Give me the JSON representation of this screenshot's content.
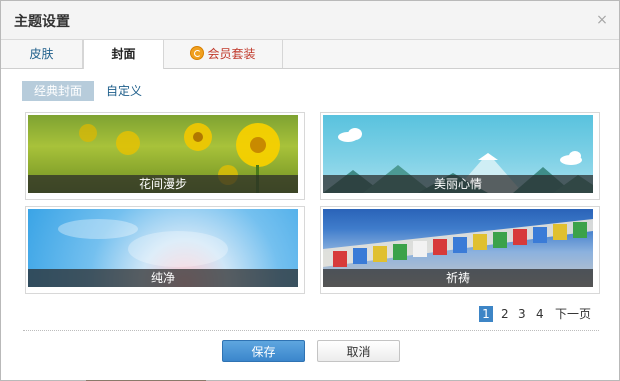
{
  "dialog": {
    "title": "主题设置",
    "close_symbol": "×"
  },
  "tabs": [
    {
      "label": "皮肤",
      "active": false
    },
    {
      "label": "封面",
      "active": true
    },
    {
      "label": "会员套装",
      "active": false,
      "icon": "vip-coin-icon"
    }
  ],
  "subtabs": [
    {
      "label": "经典封面",
      "active": true
    },
    {
      "label": "自定义",
      "active": false
    }
  ],
  "covers": [
    {
      "caption": "花间漫步"
    },
    {
      "caption": "美丽心情"
    },
    {
      "caption": "纯净"
    },
    {
      "caption": "祈祷"
    }
  ],
  "pagination": {
    "pages": [
      "1",
      "2",
      "3",
      "4"
    ],
    "current": "1",
    "next_label": "下一页"
  },
  "buttons": {
    "save_label": "保存",
    "cancel_label": "取消"
  },
  "colors": {
    "accent": "#3d85c6",
    "subtab_active_bg": "#b7ccdb",
    "vip_text": "#c0392b"
  }
}
